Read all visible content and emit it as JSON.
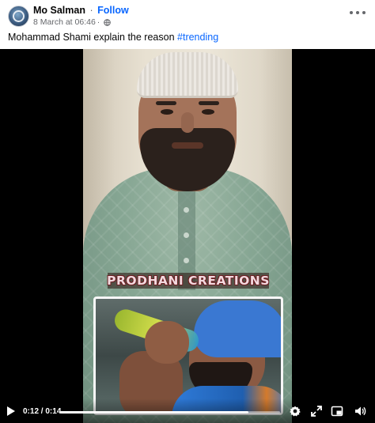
{
  "post": {
    "author": "Mo Salman",
    "separator": "·",
    "follow_label": "Follow",
    "timestamp": "8 March at 06:46",
    "timestamp_sep": "·",
    "caption_text": "Mohammad Shami explain the reason ",
    "hashtag": "#trending"
  },
  "video": {
    "watermark": "PRODHANI CREATIONS",
    "current_time": "0:12",
    "duration": "0:14",
    "time_separator": " / ",
    "progress_fraction": 0.857
  },
  "icons": {
    "avatar": "avatar",
    "globe": "globe-icon",
    "more": "more-options-icon",
    "play": "play-icon",
    "settings": "gear-icon",
    "fullscreen": "fullscreen-icon",
    "pip": "picture-in-picture-icon",
    "volume": "volume-icon"
  },
  "colors": {
    "link": "#0866ff",
    "secondary_text": "#65676b",
    "video_bg": "#000000"
  }
}
